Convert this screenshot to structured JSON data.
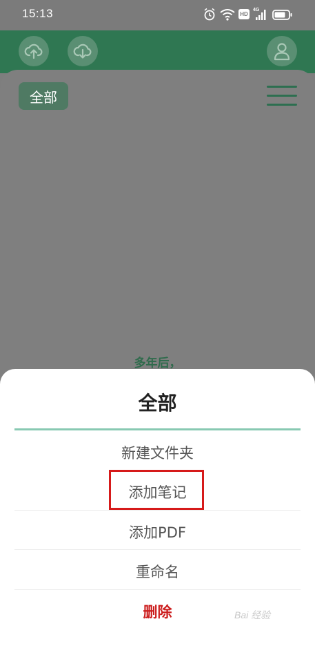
{
  "status_bar": {
    "time": "15:13",
    "icons": [
      "alarm-icon",
      "wifi-icon",
      "hd-icon",
      "signal-4g-icon",
      "battery-icon"
    ],
    "hd_label": "HD",
    "network_label": "4G"
  },
  "header": {
    "icons": [
      "cloud-upload-icon",
      "cloud-download-icon",
      "user-icon"
    ]
  },
  "toolbar": {
    "filter_label": "全部",
    "menu_icon": "hamburger-menu-icon"
  },
  "content": {
    "empty_text": "多年后，"
  },
  "sheet": {
    "title": "全部",
    "items": [
      {
        "label": "新建文件夹"
      },
      {
        "label": "添加笔记"
      },
      {
        "label": "添加PDF"
      },
      {
        "label": "重命名"
      },
      {
        "label": "删除"
      }
    ]
  },
  "watermark": {
    "text": "Bai 经验"
  },
  "colors": {
    "header_green": "#2f7752",
    "accent_line": "#88c9b2",
    "delete_red": "#cc1f1f",
    "highlight_red": "#d61a1a"
  }
}
